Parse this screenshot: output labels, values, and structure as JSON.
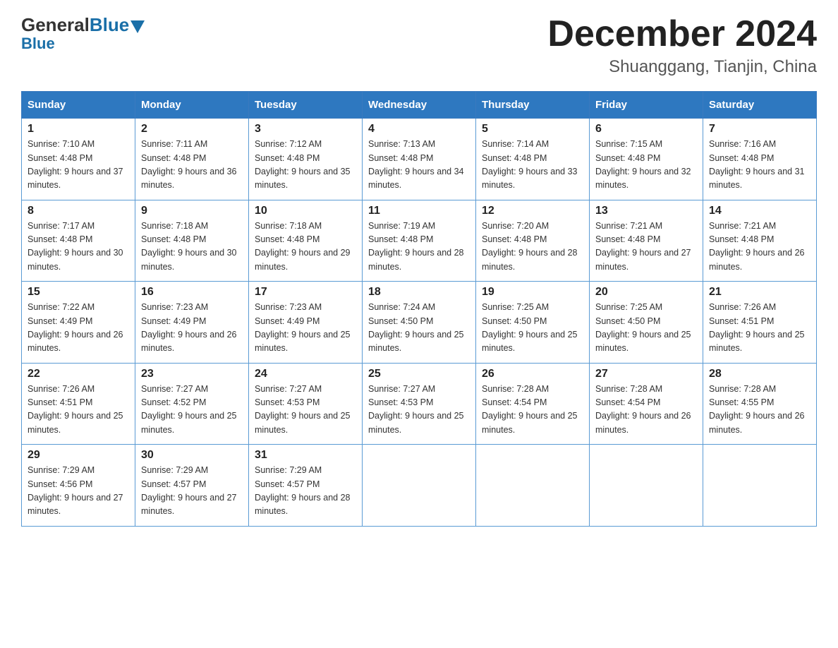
{
  "header": {
    "logo_general": "General",
    "logo_blue": "Blue",
    "main_title": "December 2024",
    "subtitle": "Shuanggang, Tianjin, China"
  },
  "days_of_week": [
    "Sunday",
    "Monday",
    "Tuesday",
    "Wednesday",
    "Thursday",
    "Friday",
    "Saturday"
  ],
  "weeks": [
    [
      {
        "day": "1",
        "sunrise": "7:10 AM",
        "sunset": "4:48 PM",
        "daylight": "9 hours and 37 minutes."
      },
      {
        "day": "2",
        "sunrise": "7:11 AM",
        "sunset": "4:48 PM",
        "daylight": "9 hours and 36 minutes."
      },
      {
        "day": "3",
        "sunrise": "7:12 AM",
        "sunset": "4:48 PM",
        "daylight": "9 hours and 35 minutes."
      },
      {
        "day": "4",
        "sunrise": "7:13 AM",
        "sunset": "4:48 PM",
        "daylight": "9 hours and 34 minutes."
      },
      {
        "day": "5",
        "sunrise": "7:14 AM",
        "sunset": "4:48 PM",
        "daylight": "9 hours and 33 minutes."
      },
      {
        "day": "6",
        "sunrise": "7:15 AM",
        "sunset": "4:48 PM",
        "daylight": "9 hours and 32 minutes."
      },
      {
        "day": "7",
        "sunrise": "7:16 AM",
        "sunset": "4:48 PM",
        "daylight": "9 hours and 31 minutes."
      }
    ],
    [
      {
        "day": "8",
        "sunrise": "7:17 AM",
        "sunset": "4:48 PM",
        "daylight": "9 hours and 30 minutes."
      },
      {
        "day": "9",
        "sunrise": "7:18 AM",
        "sunset": "4:48 PM",
        "daylight": "9 hours and 30 minutes."
      },
      {
        "day": "10",
        "sunrise": "7:18 AM",
        "sunset": "4:48 PM",
        "daylight": "9 hours and 29 minutes."
      },
      {
        "day": "11",
        "sunrise": "7:19 AM",
        "sunset": "4:48 PM",
        "daylight": "9 hours and 28 minutes."
      },
      {
        "day": "12",
        "sunrise": "7:20 AM",
        "sunset": "4:48 PM",
        "daylight": "9 hours and 28 minutes."
      },
      {
        "day": "13",
        "sunrise": "7:21 AM",
        "sunset": "4:48 PM",
        "daylight": "9 hours and 27 minutes."
      },
      {
        "day": "14",
        "sunrise": "7:21 AM",
        "sunset": "4:48 PM",
        "daylight": "9 hours and 26 minutes."
      }
    ],
    [
      {
        "day": "15",
        "sunrise": "7:22 AM",
        "sunset": "4:49 PM",
        "daylight": "9 hours and 26 minutes."
      },
      {
        "day": "16",
        "sunrise": "7:23 AM",
        "sunset": "4:49 PM",
        "daylight": "9 hours and 26 minutes."
      },
      {
        "day": "17",
        "sunrise": "7:23 AM",
        "sunset": "4:49 PM",
        "daylight": "9 hours and 25 minutes."
      },
      {
        "day": "18",
        "sunrise": "7:24 AM",
        "sunset": "4:50 PM",
        "daylight": "9 hours and 25 minutes."
      },
      {
        "day": "19",
        "sunrise": "7:25 AM",
        "sunset": "4:50 PM",
        "daylight": "9 hours and 25 minutes."
      },
      {
        "day": "20",
        "sunrise": "7:25 AM",
        "sunset": "4:50 PM",
        "daylight": "9 hours and 25 minutes."
      },
      {
        "day": "21",
        "sunrise": "7:26 AM",
        "sunset": "4:51 PM",
        "daylight": "9 hours and 25 minutes."
      }
    ],
    [
      {
        "day": "22",
        "sunrise": "7:26 AM",
        "sunset": "4:51 PM",
        "daylight": "9 hours and 25 minutes."
      },
      {
        "day": "23",
        "sunrise": "7:27 AM",
        "sunset": "4:52 PM",
        "daylight": "9 hours and 25 minutes."
      },
      {
        "day": "24",
        "sunrise": "7:27 AM",
        "sunset": "4:53 PM",
        "daylight": "9 hours and 25 minutes."
      },
      {
        "day": "25",
        "sunrise": "7:27 AM",
        "sunset": "4:53 PM",
        "daylight": "9 hours and 25 minutes."
      },
      {
        "day": "26",
        "sunrise": "7:28 AM",
        "sunset": "4:54 PM",
        "daylight": "9 hours and 25 minutes."
      },
      {
        "day": "27",
        "sunrise": "7:28 AM",
        "sunset": "4:54 PM",
        "daylight": "9 hours and 26 minutes."
      },
      {
        "day": "28",
        "sunrise": "7:28 AM",
        "sunset": "4:55 PM",
        "daylight": "9 hours and 26 minutes."
      }
    ],
    [
      {
        "day": "29",
        "sunrise": "7:29 AM",
        "sunset": "4:56 PM",
        "daylight": "9 hours and 27 minutes."
      },
      {
        "day": "30",
        "sunrise": "7:29 AM",
        "sunset": "4:57 PM",
        "daylight": "9 hours and 27 minutes."
      },
      {
        "day": "31",
        "sunrise": "7:29 AM",
        "sunset": "4:57 PM",
        "daylight": "9 hours and 28 minutes."
      },
      null,
      null,
      null,
      null
    ]
  ]
}
